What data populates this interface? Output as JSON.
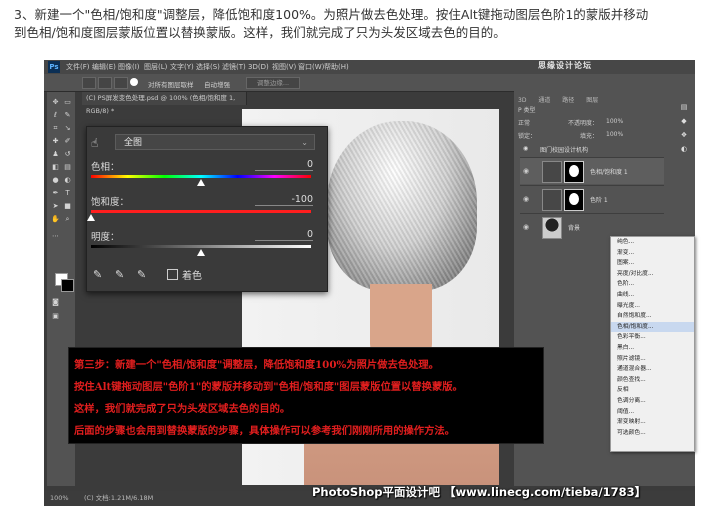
{
  "intro": {
    "line1": "3、新建一个\"色相/饱和度\"调整层，降低饱和度100%。为照片做去色处理。按住Alt键拖动图层色阶1的蒙版并移动",
    "line2": "到色相/饱和度图层蒙版位置以替换蒙版。这样，我们就完成了只为头发区域去色的目的。"
  },
  "photoshop": {
    "logo": "Ps",
    "menu": [
      "文件(F)",
      "编辑(E)",
      "图像(I)",
      "图层(L)",
      "文字(Y)",
      "选择(S)",
      "滤镜(T)",
      "3D(D)",
      "视图(V)",
      "窗口(W)",
      "帮助(H)"
    ],
    "watermark": "思缘设计论坛",
    "options": {
      "sample_all_layers": "对所有图层取样",
      "auto_enhance": "自动增强",
      "refine_edge": "调整边缘..."
    },
    "document_tab": "(C) PS屏发变色处理.psd @ 100% (色相/饱和度 1, RGB/8) *",
    "hue_sat": {
      "preset": "全图",
      "hue_label": "色相：",
      "hue_value": "0",
      "sat_label": "饱和度：",
      "sat_value": "-100",
      "light_label": "明度：",
      "light_value": "0",
      "colorize_label": "着色",
      "hue_level": 0.5,
      "sat_level": 0.0,
      "light_level": 0.5
    },
    "layers_panel": {
      "tabs": [
        "3D",
        "通道",
        "路径",
        "图层"
      ],
      "kind": "P 类型",
      "blend": "正常",
      "opacity_label": "不透明度：",
      "opacity": "100%",
      "lock_label": "锁定：",
      "fill_label": "填充：",
      "fill": "100%",
      "group": "图门校园设计机构",
      "layers": [
        {
          "name": "色相/饱和度 1"
        },
        {
          "name": "色阶 1"
        },
        {
          "name": "背景"
        }
      ]
    },
    "context_menu": [
      "纯色...",
      "渐变...",
      "图案...",
      "亮度/对比度...",
      "色阶...",
      "曲线...",
      "曝光度...",
      "自然饱和度...",
      "色相/饱和度...",
      "色彩平衡...",
      "黑白...",
      "照片滤镜...",
      "通道混合器...",
      "颜色查找...",
      "反相",
      "色调分离...",
      "阈值...",
      "渐变映射...",
      "可选颜色..."
    ],
    "context_highlight": "色相/饱和度...",
    "note": [
      "第三步：新建一个\"色相/饱和度\"调整层，降低饱和度100%为照片做去色处理。",
      "按住Alt键拖动图层\"色阶1\"的蒙版并移动到\"色相/饱和度\"图层蒙版位置以替换蒙版。",
      "这样，我们就完成了只为头发区域去色的目的。",
      "后面的步骤也会用到替换蒙版的步骤，具体操作可以参考我们刚刚所用的操作方法。"
    ],
    "status": {
      "zoom": "100%",
      "doc": "(C) 文档:1.21M/6.18M"
    },
    "footer": "PhotoShop平面设计吧 【www.linecg.com/tieba/1783】",
    "colors": {
      "ui_dark": "#3b3b3b",
      "panel": "#535353",
      "note_text": "#e01e1e",
      "sat_bar": "#ff1e1e"
    }
  }
}
